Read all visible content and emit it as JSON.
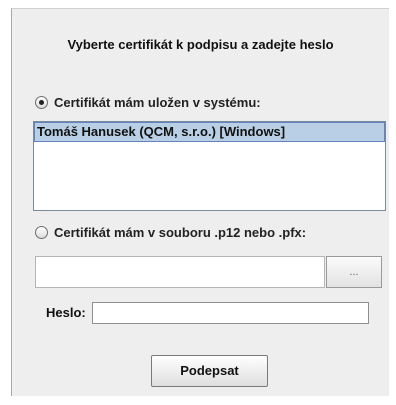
{
  "dialog": {
    "title": "Vyberte certifikát k podpisu a zadejte heslo"
  },
  "system_option": {
    "label": "Certifikát mám uložen v systému:",
    "selected": true,
    "certificates": [
      "Tomáš Hanusek (QCM, s.r.o.) [Windows]"
    ]
  },
  "file_option": {
    "label": "Certifikát mám v souboru .p12 nebo .pfx:",
    "selected": false,
    "path_value": "",
    "browse_label": "..."
  },
  "password": {
    "label": "Heslo:",
    "value": ""
  },
  "actions": {
    "sign_label": "Podepsat"
  }
}
